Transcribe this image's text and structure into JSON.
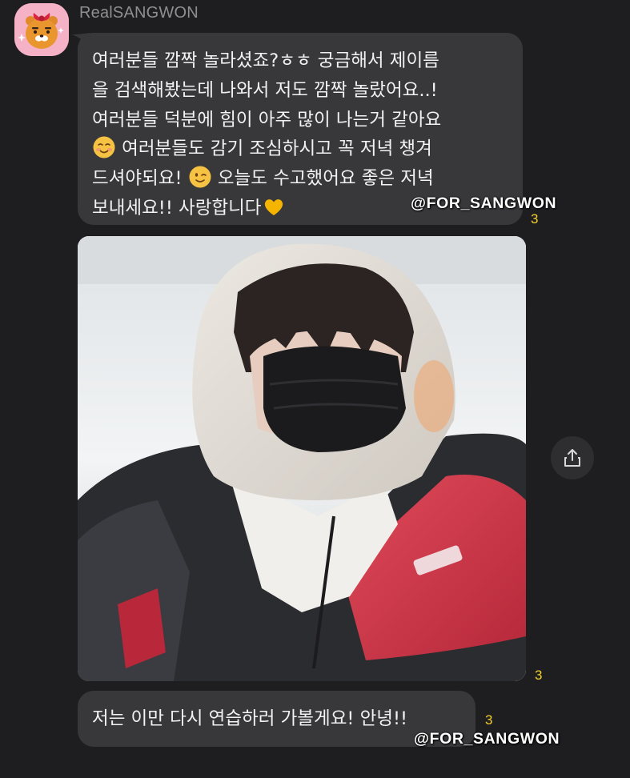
{
  "sender": {
    "name": "RealSANGWON",
    "avatar_icon": "ryan-character-icon",
    "avatar_bg": "#f5b2c6"
  },
  "messages": [
    {
      "lines": [
        "여러분들 깜짝 놀라셨죠?ㅎㅎ 궁금해서 제이름",
        "을 검색해봤는데 나와서 저도 깜짝 놀랐어요..!",
        "여러분들 덕분에 힘이 아주 많이 나는거 같아요",
        "여러분들도 감기 조심하시고 꼭 저녁 챙겨",
        "드셔야되요!",
        "오늘도 수고했어요 좋은 저녁",
        "보내세요!! 사랑합니다"
      ],
      "emojis": [
        "smiling-face-emoji",
        "winking-face-emoji",
        "yellow-heart-emoji"
      ],
      "read_count": "3"
    },
    {
      "type": "image",
      "image_icon": "selfie-photo",
      "read_count": "3"
    },
    {
      "text": "저는 이만 다시 연습하러 가볼게요! 안녕!!",
      "read_count": "3"
    }
  ],
  "share_icon": "share-icon",
  "watermark": "@FOR_SANGWON",
  "colors": {
    "background": "#1e1e20",
    "bubble": "#38383b",
    "read_count": "#f3cf2a",
    "sender_name": "#8f8f93"
  }
}
